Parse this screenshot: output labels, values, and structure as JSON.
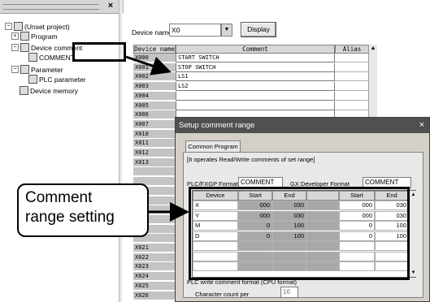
{
  "tree": {
    "close_glyph": "×",
    "items": [
      {
        "label": "(Unset project)",
        "icon": "project-icon",
        "toggle": "−"
      },
      {
        "label": "Program",
        "icon": "program-icon",
        "toggle": "+"
      },
      {
        "label": "Device comment",
        "icon": "device-comment-icon",
        "toggle": "−"
      },
      {
        "label": "COMMENT",
        "icon": "comment-file-icon",
        "toggle": ""
      },
      {
        "label": "Parameter",
        "icon": "parameter-icon",
        "toggle": "−"
      },
      {
        "label": "PLC parameter",
        "icon": "plc-parameter-icon",
        "toggle": ""
      },
      {
        "label": "Device memory",
        "icon": "device-memory-icon",
        "toggle": ""
      }
    ]
  },
  "toolbar": {
    "device_name_label": "Device name",
    "device_name_value": "X0",
    "dropdown_glyph": "▼",
    "display_label": "Display"
  },
  "grid": {
    "headers": [
      "Device name",
      "Comment",
      "Alias"
    ],
    "scroll_glyph": "▲",
    "rows": [
      {
        "device": "X000",
        "comment": "START SWITCH"
      },
      {
        "device": "X001",
        "comment": "STOP SWITCH"
      },
      {
        "device": "X002",
        "comment": "LS1"
      },
      {
        "device": "X003",
        "comment": "LS2"
      },
      {
        "device": "X004",
        "comment": ""
      },
      {
        "device": "X005",
        "comment": ""
      },
      {
        "device": "X006",
        "comment": ""
      },
      {
        "device": "X007",
        "comment": ""
      },
      {
        "device": "X010",
        "comment": ""
      },
      {
        "device": "X011",
        "comment": ""
      },
      {
        "device": "X012",
        "comment": ""
      },
      {
        "device": "X013",
        "comment": ""
      },
      {
        "device": "",
        "comment": ""
      },
      {
        "device": "",
        "comment": ""
      },
      {
        "device": "",
        "comment": ""
      },
      {
        "device": "",
        "comment": ""
      },
      {
        "device": "",
        "comment": ""
      },
      {
        "device": "",
        "comment": ""
      },
      {
        "device": "",
        "comment": ""
      },
      {
        "device": "",
        "comment": ""
      },
      {
        "device": "X021",
        "comment": ""
      },
      {
        "device": "X022",
        "comment": ""
      },
      {
        "device": "X023",
        "comment": ""
      },
      {
        "device": "X024",
        "comment": ""
      },
      {
        "device": "X025",
        "comment": ""
      },
      {
        "device": "X026",
        "comment": ""
      }
    ]
  },
  "dialog": {
    "title": "Setup comment range",
    "close_glyph": "×",
    "tab": "Common Program",
    "note": "[It operates Read/Write comments of set range]",
    "plc_format_label": "PLC/FXGP Format",
    "plc_format_value": "COMMENT",
    "gx_format_label": "GX Developer Format",
    "gx_format_value": "COMMENT",
    "table_headers": [
      "Device",
      "Start",
      "End",
      "Start",
      "End"
    ],
    "table_scroll_up": "▲",
    "table_scroll_down": "▼",
    "table_rows": [
      {
        "device": "X",
        "start1": "000",
        "end1": "030",
        "start2": "000",
        "end2": "030"
      },
      {
        "device": "Y",
        "start1": "000",
        "end1": "030",
        "start2": "000",
        "end2": "030"
      },
      {
        "device": "M",
        "start1": "0",
        "end1": "100",
        "start2": "0",
        "end2": "100"
      },
      {
        "device": "D",
        "start1": "0",
        "end1": "100",
        "start2": "0",
        "end2": "100"
      }
    ],
    "write_format_label": "PLC write comment format (CPU format)",
    "char_count_label": "Character count per",
    "char_count_value": "16"
  },
  "callout": {
    "line1": "Comment",
    "line2": "range setting"
  }
}
